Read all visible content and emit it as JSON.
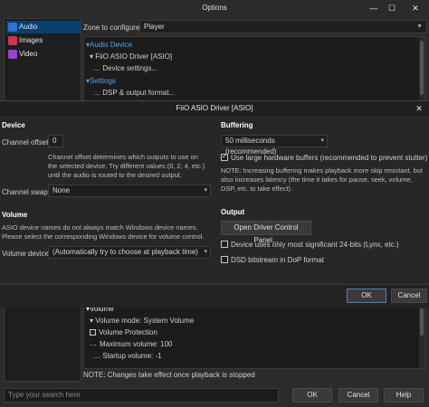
{
  "options_window": {
    "title": "Options",
    "zone_label": "Zone to configure:",
    "zone_value": "Player",
    "sidebar": [
      {
        "label": "Audio",
        "icon": "music-note-icon",
        "color": "#2f6fd6"
      },
      {
        "label": "Images",
        "icon": "image-icon",
        "color": "#d9324a"
      },
      {
        "label": "Video",
        "icon": "video-icon",
        "color": "#9b3fcf"
      }
    ],
    "tree_top": [
      {
        "kind": "group",
        "text": "▾Audio Device"
      },
      {
        "kind": "item",
        "text": "FiiO ASIO Driver [ASIO]"
      },
      {
        "kind": "item",
        "text": "Device settings..."
      },
      {
        "kind": "group",
        "text": "▾Settings"
      },
      {
        "kind": "item",
        "text": "DSP & output format..."
      }
    ],
    "tree_bottom": {
      "group": "Volume",
      "items": [
        "Volume mode: System Volume",
        "Volume Protection",
        "Maximum volume: 100",
        "Startup volume: -1"
      ]
    },
    "note": "NOTE: Changes take effect once playback is stopped",
    "search_placeholder": "Type your search here",
    "buttons": {
      "ok": "OK",
      "cancel": "Cancel",
      "help": "Help"
    }
  },
  "dialog": {
    "title": "FiiO ASIO Driver [ASIO]",
    "device": {
      "heading": "Device",
      "channel_offset_label": "Channel offset:",
      "channel_offset_value": "0",
      "channel_offset_help": "Channel offset determines which outputs to use on the selected device.  Try different values (0, 2, 4, etc.) until the audio is routed to the desired output.",
      "channel_swap_label": "Channel swap:",
      "channel_swap_value": "None"
    },
    "volume": {
      "heading": "Volume",
      "help": "ASIO device names do not always match Windows device names. Please select the corresponding Windows device for volume control.",
      "device_label": "Volume device:",
      "device_value": "(Automatically try to choose at playback time)"
    },
    "buffering": {
      "heading": "Buffering",
      "value": "50 milliseconds (recommended)",
      "large_buffers_label": "Use large hardware buffers (recommended to prevent stutter)",
      "large_buffers_checked": true,
      "note": "NOTE: Increasing buffering makes playback more skip resistant, but also increases latency (the time it takes for pause, seek, volume, DSP, etc. to take effect)."
    },
    "output": {
      "heading": "Output",
      "open_panel_label": "Open Driver Control Panel...",
      "msb_label": "Device uses only most significant 24-bits (Lynx, etc.)",
      "dsd_label": "DSD bitstream in DoP format"
    },
    "buttons": {
      "ok": "OK",
      "cancel": "Cancel"
    }
  }
}
